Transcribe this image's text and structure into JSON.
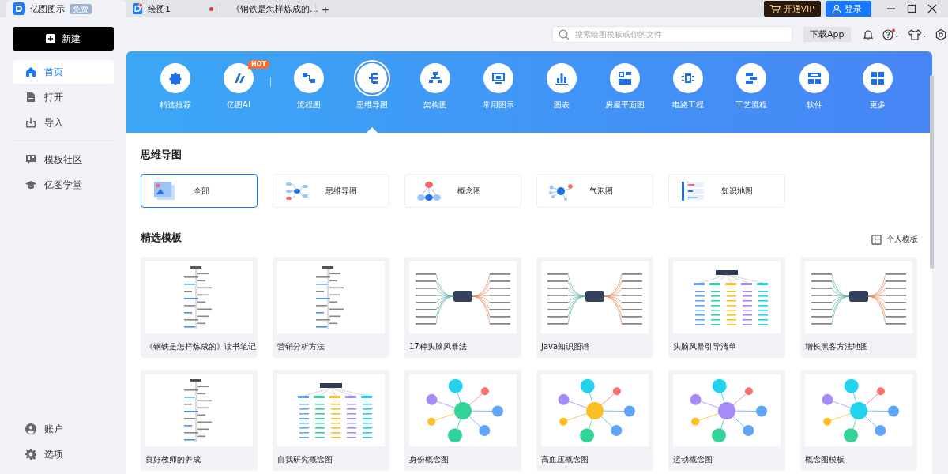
{
  "tabs": [
    {
      "kind": "home",
      "label": "亿图图示",
      "badge": "免费",
      "selected": true
    },
    {
      "kind": "doc",
      "label": "绘图1",
      "selected": false,
      "unsaved": true
    },
    {
      "kind": "doc",
      "label": "《钢铁是怎样炼成的…",
      "selected": false,
      "unsaved": false
    }
  ],
  "new_tab": "+",
  "vip_button": "开通VIP",
  "login_button": "登录",
  "sidebar": {
    "new_button": "新建",
    "items": [
      {
        "label": "首页",
        "selected": true
      },
      {
        "label": "打开",
        "selected": false
      },
      {
        "label": "导入",
        "selected": false
      },
      {
        "label": "模板社区",
        "selected": false
      },
      {
        "label": "亿图学堂",
        "selected": false
      }
    ],
    "bottom_items": [
      {
        "label": "账户",
        "selected": false
      },
      {
        "label": "选项",
        "selected": false
      }
    ]
  },
  "toolbar": {
    "search_placeholder": "搜索绘图模板或你的文件",
    "download_button": "下载App",
    "help_badge": true
  },
  "categories": [
    {
      "label": "精选推荐",
      "selected": false
    },
    {
      "label": "亿图AI",
      "selected": false,
      "badge": "HOT"
    },
    {
      "label": "流程图",
      "selected": false
    },
    {
      "label": "思维导图",
      "selected": true
    },
    {
      "label": "架构图",
      "selected": false
    },
    {
      "label": "常用图示",
      "selected": false
    },
    {
      "label": "图表",
      "selected": false
    },
    {
      "label": "房屋平面图",
      "selected": false
    },
    {
      "label": "电路工程",
      "selected": false
    },
    {
      "label": "工艺流程",
      "selected": false
    },
    {
      "label": "软件",
      "selected": false
    },
    {
      "label": "更多",
      "selected": false
    }
  ],
  "section_title": "思维导图",
  "subtypes": [
    {
      "label": "全部",
      "selected": true
    },
    {
      "label": "思维导图",
      "selected": false
    },
    {
      "label": "概念图",
      "selected": false
    },
    {
      "label": "气泡图",
      "selected": false
    },
    {
      "label": "知识地图",
      "selected": false
    }
  ],
  "templates_title": "精选模板",
  "personal_templates": "个人模板",
  "templates": [
    {
      "title": "《钢铁是怎样炼成的》读书笔记"
    },
    {
      "title": "营销分析方法"
    },
    {
      "title": "17种头脑风暴法"
    },
    {
      "title": "Java知识图谱"
    },
    {
      "title": "头脑风暴引导清单"
    },
    {
      "title": "增长黑客方法地图"
    },
    {
      "title": "良好教师的养成"
    },
    {
      "title": "自我研究概念图"
    },
    {
      "title": "身份概念图"
    },
    {
      "title": "高血压概念图"
    },
    {
      "title": "运动概念图"
    },
    {
      "title": "概念图模板"
    }
  ]
}
